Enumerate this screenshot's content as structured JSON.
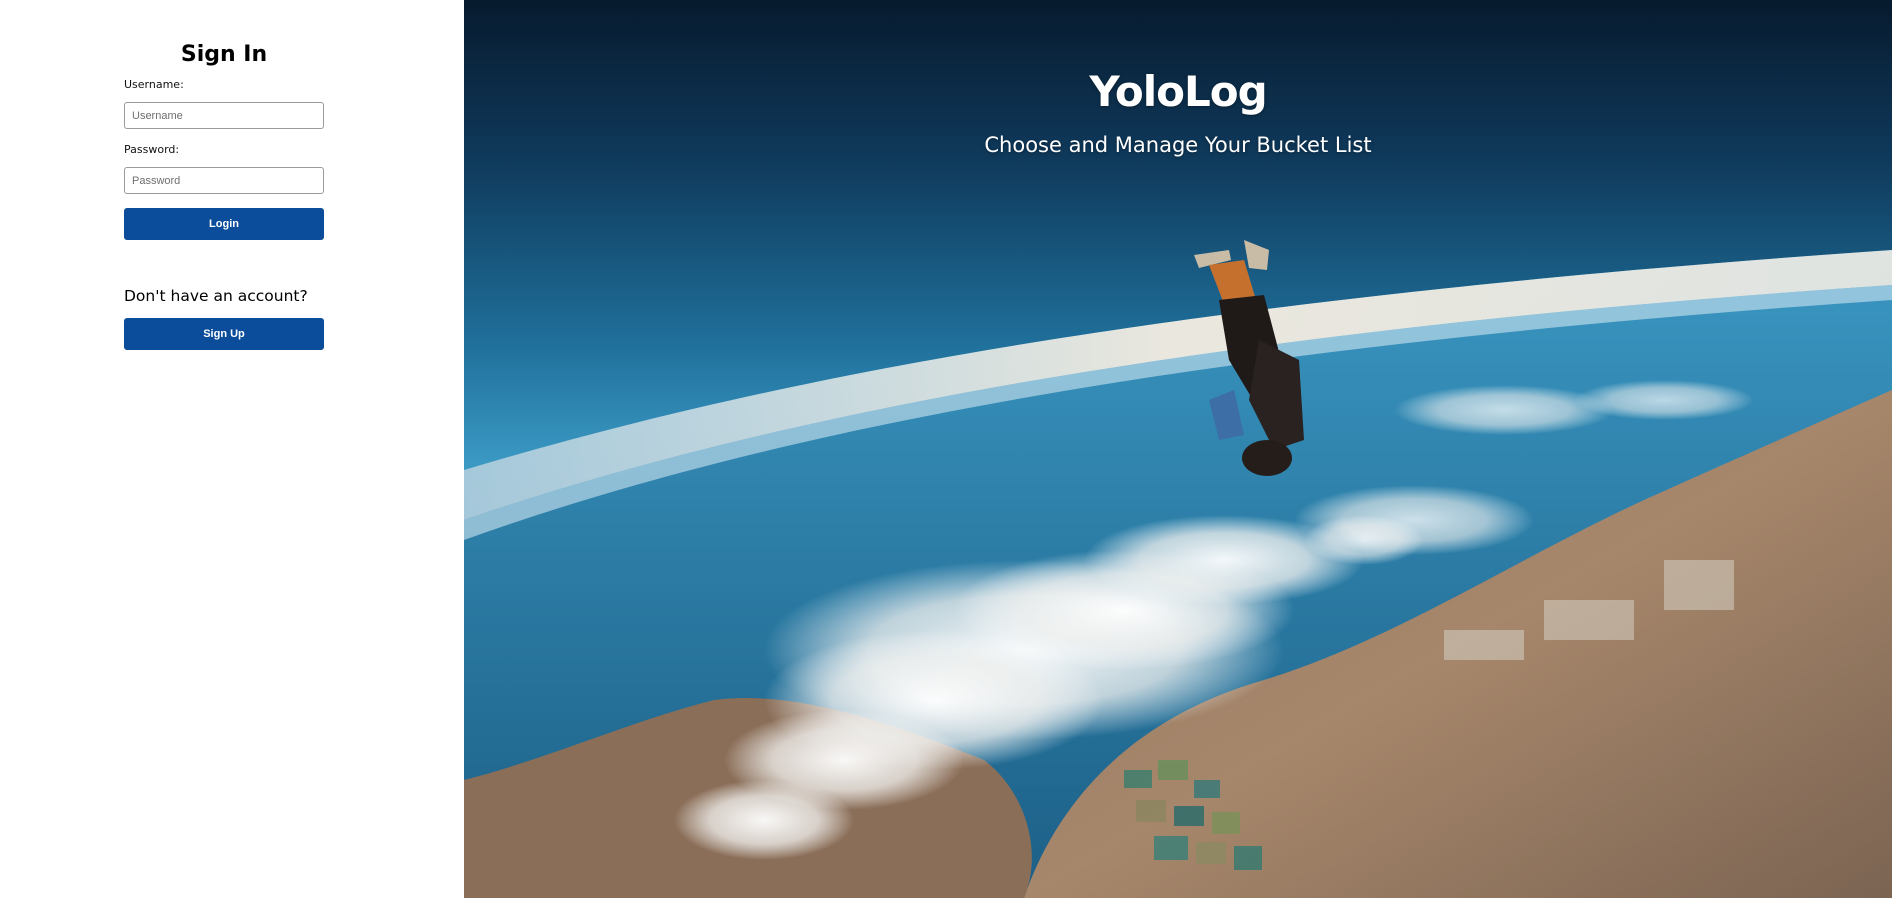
{
  "signin": {
    "title": "Sign In",
    "username_label": "Username:",
    "username_placeholder": "Username",
    "username_value": "",
    "password_label": "Password:",
    "password_placeholder": "Password",
    "password_value": "",
    "login_label": "Login",
    "signup_prompt": "Don't have an account?",
    "signup_label": "Sign Up"
  },
  "hero": {
    "title": "YoloLog",
    "subtitle": "Choose and Manage Your Bucket List",
    "image": "skydiver-over-coastline-photo"
  },
  "colors": {
    "accent": "#0c4d9b",
    "panel_background": "#ffffff",
    "hero_text": "#ffffff"
  }
}
